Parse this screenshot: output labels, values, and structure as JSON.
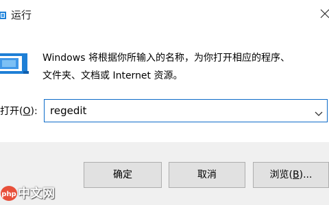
{
  "window": {
    "title": "运行",
    "title_icon": "run-icon",
    "close_icon": "close-icon"
  },
  "body": {
    "icon": "run-dialog-icon",
    "description_line1": "Windows 将根据你所输入的名称，为你打开相应的程序、",
    "description_line2": "文件夹、文档或 Internet 资源。",
    "open_label_prefix": "打开(",
    "open_label_key": "O",
    "open_label_suffix": "):",
    "open_value": "regedit",
    "dropdown_icon": "chevron-down-icon"
  },
  "buttons": {
    "ok_label": "确定",
    "cancel_label": "取消",
    "browse_prefix": "浏览(",
    "browse_key": "B",
    "browse_suffix": ")..."
  },
  "watermark": {
    "logo_text": "php",
    "site_text": "中文网"
  },
  "colors": {
    "input_border": "#0a6ac8",
    "footer_bg": "#f0f0f0",
    "button_bg": "#e1e1e1",
    "icon_blue": "#1e7fd6"
  }
}
